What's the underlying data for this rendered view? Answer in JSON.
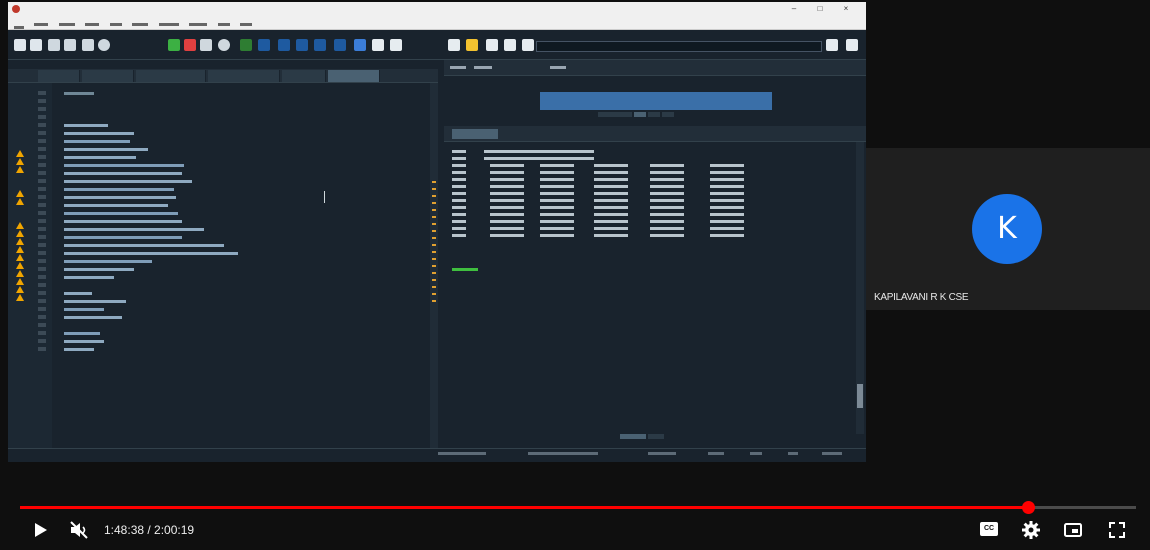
{
  "video": {
    "current_time": "1:48:38",
    "duration": "2:00:19",
    "time_display": "1:48:38 / 2:00:19",
    "progress": 0.9029
  },
  "participant": {
    "initial": "K",
    "name": "KAPILAVANI R K CSE",
    "avatar_color": "#1a73e8"
  },
  "controls": {
    "cc_label": "CC"
  },
  "colors": {
    "progress": "#ff0000",
    "ide_bg": "#19232d",
    "prompt": "#3fbf3f"
  },
  "icons": [
    "play-icon",
    "muted-volume-icon",
    "closed-captions-icon",
    "settings-gear-icon",
    "miniplayer-icon",
    "fullscreen-icon"
  ]
}
